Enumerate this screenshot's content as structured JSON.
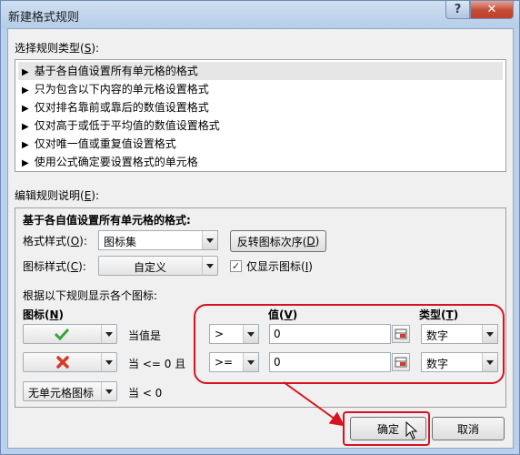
{
  "window": {
    "title": "新建格式规则",
    "help_glyph": "?",
    "close_glyph": "✕"
  },
  "rule_type": {
    "label": "选择规则类型(",
    "hotkey": "S",
    "label_end": "):",
    "items": [
      {
        "label": "基于各自值设置所有单元格的格式",
        "selected": true
      },
      {
        "label": "只为包含以下内容的单元格设置格式",
        "selected": false
      },
      {
        "label": "仅对排名靠前或靠后的数值设置格式",
        "selected": false
      },
      {
        "label": "仅对高于或低于平均值的数值设置格式",
        "selected": false
      },
      {
        "label": "仅对唯一值或重复值设置格式",
        "selected": false
      },
      {
        "label": "使用公式确定要设置格式的单元格",
        "selected": false
      }
    ]
  },
  "edit": {
    "label": "编辑规则说明(",
    "hotkey": "E",
    "label_end": "):",
    "heading": "基于各自值设置所有单元格的格式:",
    "format_style_label": "格式样式(",
    "format_style_hotkey": "O",
    "format_style_end": "):",
    "format_style_value": "图标集",
    "reverse_button": "反转图标次序(",
    "reverse_hotkey": "D",
    "reverse_end": ")",
    "icon_style_label": "图标样式(",
    "icon_style_hotkey": "C",
    "icon_style_end": "):",
    "icon_style_value": "自定义",
    "show_icon_only_label": "仅显示图标(",
    "show_icon_only_hotkey": "I",
    "show_icon_only_end": ")",
    "show_icon_only_checked": true,
    "rules_caption": "根据以下规则显示各个图标:",
    "col_icon": "图标(",
    "col_icon_hotkey": "N",
    "col_icon_end": ")",
    "col_value": "值(",
    "col_value_hotkey": "V",
    "col_value_end": ")",
    "col_type": "类型(",
    "col_type_hotkey": "T",
    "col_type_end": ")",
    "rows": [
      {
        "icon": "green-check-icon",
        "condition": "当值是",
        "operator": ">",
        "value": "0",
        "type": "数字"
      },
      {
        "icon": "red-x-icon",
        "condition": "当 <= 0 且",
        "operator": ">=",
        "value": "0",
        "type": "数字"
      },
      {
        "icon": "no-cell-icon",
        "icon_label": "无单元格图标",
        "condition": "当 < 0"
      }
    ]
  },
  "buttons": {
    "ok": "确定",
    "cancel": "取消"
  },
  "colors": {
    "highlight": "#d8121e",
    "check": "#3aa33a",
    "cross": "#d33a2a"
  }
}
